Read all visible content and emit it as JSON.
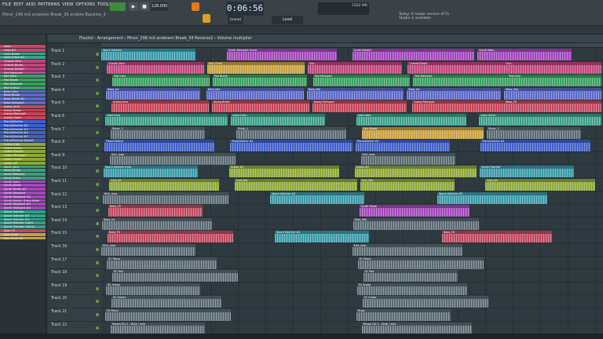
{
  "menu": [
    "FILE",
    "EDIT",
    "ADD",
    "PATTERNS",
    "VIEW",
    "OPTIONS",
    "TOOLS",
    "HELP"
  ],
  "song_title": "Minor_298 mit anderem Break_36 andere Bassline_2",
  "tempo": "128.000",
  "time": "0:06:56",
  "snap": "(none)",
  "tool": "Lead",
  "cpu": "2562 MB",
  "news": "Today: A newer version of FL Studio is available",
  "breadcrumb": "Playlist - Arrangement › Minor_298 mit anderem Break_34 Reverse2 › Volume multiplier",
  "patterns": [
    {
      "name": "Lead",
      "color": "#c9456a"
    },
    {
      "name": "Lead #2",
      "color": "#c9456a"
    },
    {
      "name": "Lead Break",
      "color": "#3da08a"
    },
    {
      "name": "Lead Outro #2",
      "color": "#3da08a"
    },
    {
      "name": "Chords Intro",
      "color": "#c0447c"
    },
    {
      "name": "Chords Break",
      "color": "#c0447c"
    },
    {
      "name": "Chords Break2",
      "color": "#c0447c"
    },
    {
      "name": "Pad Mainpart",
      "color": "#b84aa0"
    },
    {
      "name": "Pad Intro",
      "color": "#3aa060"
    },
    {
      "name": "Pad Break",
      "color": "#3aa060"
    },
    {
      "name": "Pad Mainpart",
      "color": "#3aa060"
    },
    {
      "name": "Pad Outro2",
      "color": "#3aa060"
    },
    {
      "name": "Bass Intro",
      "color": "#5b6ac8"
    },
    {
      "name": "Bass Break",
      "color": "#5b6ac8"
    },
    {
      "name": "Bass Break #2",
      "color": "#5b6ac8"
    },
    {
      "name": "Bass Mainpart",
      "color": "#5b6ac8"
    },
    {
      "name": "Arpeg Intro",
      "color": "#c84458"
    },
    {
      "name": "Arpeg Break",
      "color": "#c84458"
    },
    {
      "name": "Arpeg Mainpart",
      "color": "#c84458"
    },
    {
      "name": "Arpeg Outro",
      "color": "#c84458"
    },
    {
      "name": "Piano/Viovine",
      "color": "#4060c8"
    },
    {
      "name": "Piano/Viovine #2",
      "color": "#4060c8"
    },
    {
      "name": "Piano/Viovine #3",
      "color": "#4060c8"
    },
    {
      "name": "Piano/Viovine #4",
      "color": "#4060c8"
    },
    {
      "name": "Piano/Viovine #5",
      "color": "#4060c8"
    },
    {
      "name": "Piano/Viovine Break2",
      "color": "#4060c8"
    },
    {
      "name": "Guitar Intro",
      "color": "#8ea83a"
    },
    {
      "name": "Guitar Break",
      "color": "#8ea83a"
    },
    {
      "name": "Guitar Break2",
      "color": "#8ea83a"
    },
    {
      "name": "Guitar Mainpart",
      "color": "#8ea83a"
    },
    {
      "name": "Guitar Outro",
      "color": "#8ea83a"
    },
    {
      "name": "Guitar #2",
      "color": "#8ea83a"
    },
    {
      "name": "Vocal Intro",
      "color": "#3aa07a"
    },
    {
      "name": "Vocal Break",
      "color": "#3aa07a"
    },
    {
      "name": "Vocal Mainpart",
      "color": "#3aa07a"
    },
    {
      "name": "Vocal Outro",
      "color": "#3aa07a"
    },
    {
      "name": "Synth Intro",
      "color": "#a048b8"
    },
    {
      "name": "Synth Break",
      "color": "#a048b8"
    },
    {
      "name": "Synth Break #2",
      "color": "#a048b8"
    },
    {
      "name": "Synth Mainpart",
      "color": "#a048b8"
    },
    {
      "name": "Synth Mainpart #2",
      "color": "#a048b8"
    },
    {
      "name": "Synth Mainp. Outro Nihel",
      "color": "#a048b8"
    },
    {
      "name": "Synth Mainpart #3",
      "color": "#a048b8"
    },
    {
      "name": "Synth Mainpart #4",
      "color": "#a048b8"
    },
    {
      "name": "Spore Hatcher",
      "color": "#30a088"
    },
    {
      "name": "Spore Hatcher #2",
      "color": "#30a088"
    },
    {
      "name": "Spore Hatcher #3",
      "color": "#30a088"
    },
    {
      "name": "Spore Hatcher Outro",
      "color": "#30a088"
    },
    {
      "name": "Spore Hatcher Outro2",
      "color": "#30a088"
    },
    {
      "name": "Bass FX",
      "color": "#c04860"
    },
    {
      "name": "Epic Choir",
      "color": "#c8a040"
    },
    {
      "name": "Epic Choir #2",
      "color": "#c8a040"
    }
  ],
  "tracks": [
    {
      "name": "Track 1",
      "clips": [
        {
          "label": "Spore Hatcher",
          "color": "#3a9aa8"
        },
        {
          "label": "Synth Mainpart Outro",
          "color": "#a048b8"
        },
        {
          "label": "Synth Break2",
          "color": "#a048b8"
        },
        {
          "label": "Synth Main...",
          "color": "#a048b8"
        }
      ]
    },
    {
      "name": "Track 2",
      "clips": [
        {
          "label": "Chords Intro",
          "color": "#c0447c"
        },
        {
          "label": "Epic Choir",
          "color": "#c8a040"
        },
        {
          "label": "Cho...",
          "color": "#c0447c"
        },
        {
          "label": "Chords Break",
          "color": "#c0447c"
        },
        {
          "label": "Cho...",
          "color": "#c0447c"
        }
      ]
    },
    {
      "name": "Track 3",
      "clips": [
        {
          "label": "Pad Intro",
          "color": "#3aa060"
        },
        {
          "label": "Pad Break",
          "color": "#3aa060"
        },
        {
          "label": "Pad Mainpart",
          "color": "#3aa060"
        },
        {
          "label": "Pad Mainpart",
          "color": "#3aa060"
        },
        {
          "label": "Pad Intro",
          "color": "#3aa060"
        }
      ]
    },
    {
      "name": "Track 4",
      "clips": [
        {
          "label": "Bass_Int",
          "color": "#5b6ac8"
        },
        {
          "label": "Bass_Bre",
          "color": "#5b6ac8"
        },
        {
          "label": "Bass_Mai",
          "color": "#5b6ac8"
        },
        {
          "label": "Bass_Int",
          "color": "#5b6ac8"
        },
        {
          "label": "Bass_Mai",
          "color": "#5b6ac8"
        }
      ]
    },
    {
      "name": "Track 5",
      "clips": [
        {
          "label": "Arpeg Intro",
          "color": "#c84458"
        },
        {
          "label": "Arpeg Break",
          "color": "#c84458"
        },
        {
          "label": "Arpeg Mainpart",
          "color": "#c84458"
        },
        {
          "label": "Arpeg Mainpart",
          "color": "#c84458"
        },
        {
          "label": "Bass_FX",
          "color": "#c04860"
        }
      ]
    },
    {
      "name": "Track 6",
      "clips": [
        {
          "label": "Lead Intro",
          "color": "#3da08a"
        },
        {
          "label": "Lead Outro",
          "color": "#3da08a"
        },
        {
          "label": "Lead Intro",
          "color": "#3da08a"
        },
        {
          "label": "Lead Outro",
          "color": "#3da08a"
        }
      ]
    },
    {
      "name": "Track 7",
      "clips": [
        {
          "label": "Music_1",
          "color": "#5a6a72"
        },
        {
          "label": "Music_1",
          "color": "#5a6a72"
        },
        {
          "label": "Epic Break",
          "color": "#c8a040"
        },
        {
          "label": "Music_1",
          "color": "#5a6a72"
        }
      ]
    },
    {
      "name": "Track 8",
      "clips": [
        {
          "label": "Piano/Violine",
          "color": "#4060c8"
        },
        {
          "label": "Piano/Violine #2",
          "color": "#4060c8"
        },
        {
          "label": "Piano/Violine #3",
          "color": "#4060c8"
        },
        {
          "label": "Piano/Violine #4",
          "color": "#4060c8"
        }
      ]
    },
    {
      "name": "Track 9",
      "clips": [
        {
          "label": "Kick_loop",
          "color": "#5a6a72"
        },
        {
          "label": "Kick_loop",
          "color": "#5a6a72"
        }
      ]
    },
    {
      "name": "Track 10",
      "clips": [
        {
          "label": "Spore Hatcher Intro",
          "color": "#3a9aa8"
        },
        {
          "label": "Guitar #2",
          "color": "#8ea83a"
        },
        {
          "label": "Guitar #2",
          "color": "#8ea83a"
        },
        {
          "label": "Spore Hatcher",
          "color": "#3a9aa8"
        }
      ]
    },
    {
      "name": "Track 11",
      "clips": [
        {
          "label": "Guit_Int",
          "color": "#8ea83a"
        },
        {
          "label": "Guit_Bre",
          "color": "#8ea83a"
        },
        {
          "label": "Guit_Mai",
          "color": "#8ea83a"
        },
        {
          "label": "Guit_Int",
          "color": "#8ea83a"
        }
      ]
    },
    {
      "name": "Track 12",
      "clips": [
        {
          "label": "Kick_loop",
          "color": "#5a6a72"
        },
        {
          "label": "Spore Hatcher #2",
          "color": "#3a9aa8"
        },
        {
          "label": "Spore Hatcher #3",
          "color": "#3a9aa8"
        }
      ]
    },
    {
      "name": "Track 13",
      "clips": [
        {
          "label": "Bass_FX",
          "color": "#c04860"
        },
        {
          "label": "Synth Break",
          "color": "#a048b8"
        }
      ]
    },
    {
      "name": "Track 14",
      "clips": [
        {
          "label": "Bass_Int",
          "color": "#5a6a72"
        },
        {
          "label": "Bass_Mai",
          "color": "#5a6a72"
        }
      ]
    },
    {
      "name": "Track 15",
      "clips": [
        {
          "label": "Bass_FX",
          "color": "#c04860"
        },
        {
          "label": "Spore Hatcher #2",
          "color": "#3a9aa8"
        },
        {
          "label": "Bass_FX",
          "color": "#c04860"
        }
      ]
    },
    {
      "name": "Track 16",
      "clips": [
        {
          "label": "Kick_loop",
          "color": "#5a6a72"
        },
        {
          "label": "Kick_loop",
          "color": "#5a6a72"
        }
      ]
    },
    {
      "name": "Track 17",
      "clips": [
        {
          "label": "SC Piano",
          "color": "#5a6a72"
        },
        {
          "label": "SC Piano",
          "color": "#5a6a72"
        }
      ]
    },
    {
      "name": "Track 18",
      "clips": [
        {
          "label": "SC Pad",
          "color": "#5a6a72"
        },
        {
          "label": "SC Pad",
          "color": "#5a6a72"
        }
      ]
    },
    {
      "name": "Track 19",
      "clips": [
        {
          "label": "SC Arpeg",
          "color": "#5a6a72"
        },
        {
          "label": "SC Arpeg",
          "color": "#5a6a72"
        }
      ]
    },
    {
      "name": "Track 20",
      "clips": [
        {
          "label": "SC Guitar",
          "color": "#5a6a72"
        },
        {
          "label": "SC Guitar",
          "color": "#5a6a72"
        }
      ]
    },
    {
      "name": "Track 21",
      "clips": [
        {
          "label": "FX Piano",
          "color": "#5a6a72"
        },
        {
          "label": "Music",
          "color": "#5a6a72"
        }
      ]
    },
    {
      "name": "Track 22",
      "clips": [
        {
          "label": "Param EQ 2 - Mute / solo",
          "color": "#5a6a72"
        },
        {
          "label": "Param EQ 2 - Mute / solo",
          "color": "#5a6a72"
        }
      ]
    }
  ]
}
